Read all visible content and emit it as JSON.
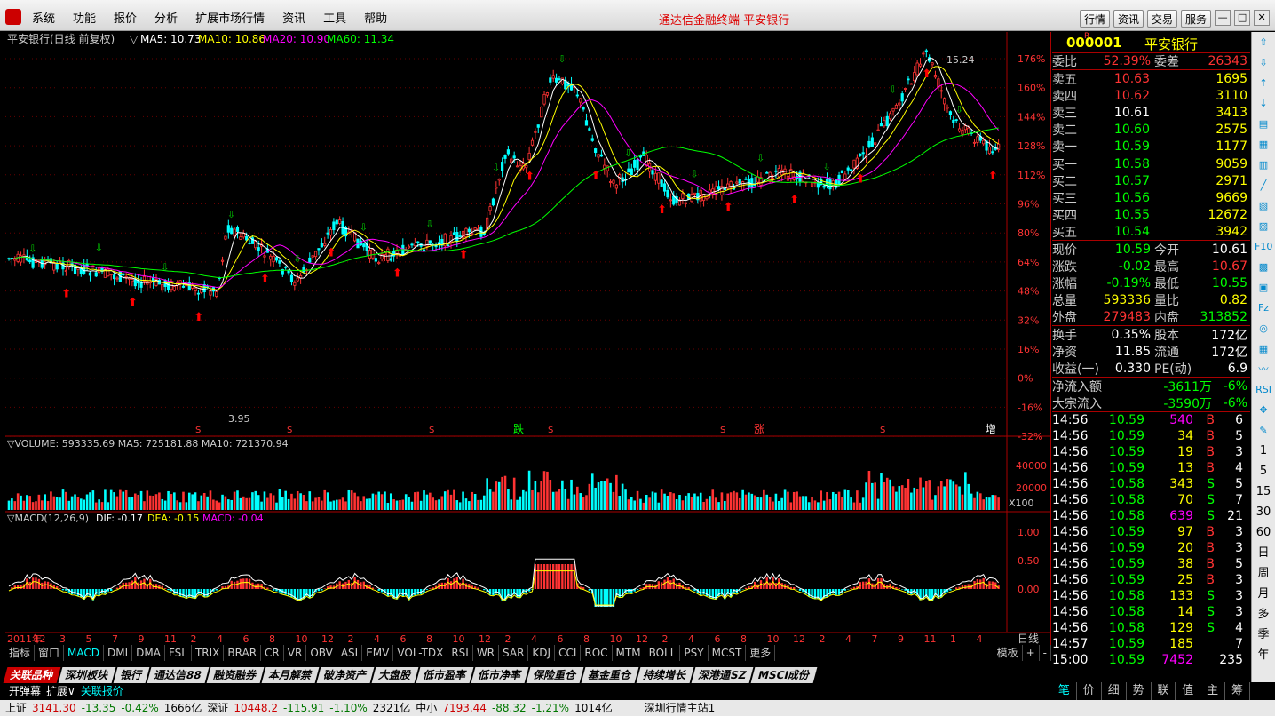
{
  "menubar": {
    "items": [
      "系统",
      "功能",
      "报价",
      "分析",
      "扩展市场行情",
      "资讯",
      "工具",
      "帮助"
    ],
    "title": "通达信金融终端  平安银行",
    "buttons": [
      "行情",
      "资讯",
      "交易",
      "服务"
    ]
  },
  "chart": {
    "main_header": {
      "name": "平安银行(日线 前复权)",
      "ma5": "MA5: 10.73",
      "ma10": "MA10: 10.86",
      "ma20": "MA20: 10.90",
      "ma60": "MA60: 11.34"
    },
    "pct_axis": [
      "176%",
      "160%",
      "144%",
      "128%",
      "112%",
      "96%",
      "80%",
      "64%",
      "48%",
      "32%",
      "16%",
      "0%",
      "-16%",
      "-32%"
    ],
    "high_label": "15.24",
    "low_label": "3.95",
    "markers": [
      "跌",
      "涨",
      "增"
    ],
    "vol_header": "▽VOLUME: 593335.69  MA5: 725181.88  MA10: 721370.94",
    "vol_axis": [
      "40000",
      "20000"
    ],
    "vol_unit": "X100",
    "macd_header": {
      "name": "▽MACD(12,26,9)",
      "dif": "DIF: -0.17",
      "dea": "DEA: -0.15",
      "macd": "MACD: -0.04"
    },
    "macd_axis": [
      "1.00",
      "0.50",
      "0.00"
    ],
    "date_axis": [
      "2011年",
      "12",
      "3",
      "5",
      "7",
      "9",
      "11",
      "2",
      "4",
      "6",
      "8",
      "10",
      "12",
      "2",
      "4",
      "6",
      "8",
      "10",
      "12",
      "2",
      "4",
      "6",
      "8",
      "10",
      "12",
      "2",
      "4",
      "6",
      "8",
      "10",
      "12",
      "2",
      "4",
      "7",
      "9",
      "11",
      "1",
      "4"
    ],
    "period_label": "日线"
  },
  "indicator_tabs": [
    "指标",
    "窗口",
    "MACD",
    "DMI",
    "DMA",
    "FSL",
    "TRIX",
    "BRAR",
    "CR",
    "VR",
    "OBV",
    "ASI",
    "EMV",
    "VOL-TDX",
    "RSI",
    "WR",
    "SAR",
    "KDJ",
    "CCI",
    "ROC",
    "MTM",
    "BOLL",
    "PSY",
    "MCST",
    "更多"
  ],
  "template_label": "模板",
  "category_tabs": [
    "关联品种",
    "深圳板块",
    "银行",
    "通达信88",
    "融资融券",
    "本月解禁",
    "破净资产",
    "大盘股",
    "低市盈率",
    "低市净率",
    "保险重仓",
    "基金重仓",
    "持续增长",
    "深港通SZ",
    "MSCI成份"
  ],
  "bottom_bar": [
    "开弹幕",
    "扩展∨",
    "关联报价"
  ],
  "quote": {
    "code": "000001",
    "name": "平安银行",
    "rongzi": "R",
    "weibi": {
      "label": "委比",
      "value": "52.39%",
      "label2": "委差",
      "value2": "26343"
    },
    "asks": [
      {
        "label": "卖五",
        "price": "10.63",
        "vol": "1695"
      },
      {
        "label": "卖四",
        "price": "10.62",
        "vol": "3110"
      },
      {
        "label": "卖三",
        "price": "10.61",
        "vol": "3413"
      },
      {
        "label": "卖二",
        "price": "10.60",
        "vol": "2575"
      },
      {
        "label": "卖一",
        "price": "10.59",
        "vol": "1177"
      }
    ],
    "bids": [
      {
        "label": "买一",
        "price": "10.58",
        "vol": "9059"
      },
      {
        "label": "买二",
        "price": "10.57",
        "vol": "2971"
      },
      {
        "label": "买三",
        "price": "10.56",
        "vol": "9669"
      },
      {
        "label": "买四",
        "price": "10.55",
        "vol": "12672"
      },
      {
        "label": "买五",
        "price": "10.54",
        "vol": "3942"
      }
    ],
    "stats": [
      {
        "l1": "现价",
        "v1": "10.59",
        "l2": "今开",
        "v2": "10.61"
      },
      {
        "l1": "涨跌",
        "v1": "-0.02",
        "l2": "最高",
        "v2": "10.67"
      },
      {
        "l1": "涨幅",
        "v1": "-0.19%",
        "l2": "最低",
        "v2": "10.55"
      },
      {
        "l1": "总量",
        "v1": "593336",
        "l2": "量比",
        "v2": "0.82"
      },
      {
        "l1": "外盘",
        "v1": "279483",
        "l2": "内盘",
        "v2": "313852"
      }
    ],
    "stats2": [
      {
        "l1": "换手",
        "v1": "0.35%",
        "l2": "股本",
        "v2": "172亿"
      },
      {
        "l1": "净资",
        "v1": "11.85",
        "l2": "流通",
        "v2": "172亿"
      },
      {
        "l1": "收益(一)",
        "v1": "0.330",
        "l2": "PE(动)",
        "v2": "6.9"
      }
    ],
    "flows": [
      {
        "label": "净流入额",
        "value": "-3611万",
        "pct": "-6%"
      },
      {
        "label": "大宗流入",
        "value": "-3590万",
        "pct": "-6%"
      }
    ],
    "ticks": [
      {
        "t": "14:56",
        "p": "10.59",
        "v": "540",
        "bs": "B",
        "n": "6"
      },
      {
        "t": "14:56",
        "p": "10.59",
        "v": "34",
        "bs": "B",
        "n": "5"
      },
      {
        "t": "14:56",
        "p": "10.59",
        "v": "19",
        "bs": "B",
        "n": "3"
      },
      {
        "t": "14:56",
        "p": "10.59",
        "v": "13",
        "bs": "B",
        "n": "4"
      },
      {
        "t": "14:56",
        "p": "10.58",
        "v": "343",
        "bs": "S",
        "n": "5"
      },
      {
        "t": "14:56",
        "p": "10.58",
        "v": "70",
        "bs": "S",
        "n": "7"
      },
      {
        "t": "14:56",
        "p": "10.58",
        "v": "639",
        "bs": "S",
        "n": "21"
      },
      {
        "t": "14:56",
        "p": "10.59",
        "v": "97",
        "bs": "B",
        "n": "3"
      },
      {
        "t": "14:56",
        "p": "10.59",
        "v": "20",
        "bs": "B",
        "n": "3"
      },
      {
        "t": "14:56",
        "p": "10.59",
        "v": "38",
        "bs": "B",
        "n": "5"
      },
      {
        "t": "14:56",
        "p": "10.59",
        "v": "25",
        "bs": "B",
        "n": "3"
      },
      {
        "t": "14:56",
        "p": "10.58",
        "v": "133",
        "bs": "S",
        "n": "3"
      },
      {
        "t": "14:56",
        "p": "10.58",
        "v": "14",
        "bs": "S",
        "n": "3"
      },
      {
        "t": "14:56",
        "p": "10.58",
        "v": "129",
        "bs": "S",
        "n": "4"
      },
      {
        "t": "14:57",
        "p": "10.59",
        "v": "185",
        "bs": "",
        "n": "7"
      },
      {
        "t": "15:00",
        "p": "10.59",
        "v": "7452",
        "bs": "",
        "n": "235"
      }
    ]
  },
  "right_tabs": [
    "笔",
    "价",
    "细",
    "势",
    "联",
    "值",
    "主",
    "筹"
  ],
  "right_tools": [
    "⇧",
    "⇩",
    "↑",
    "↓",
    "▤",
    "▦",
    "▥",
    "╱",
    "▧",
    "▨",
    "F10",
    "▩",
    "▣",
    "Fz",
    "◎",
    "▦",
    "〰",
    "RSI",
    "✥",
    "✎"
  ],
  "right_tools2": [
    "1",
    "5",
    "15",
    "30",
    "60",
    "日",
    "周",
    "月",
    "多",
    "季",
    "年"
  ],
  "status": {
    "sh": {
      "label": "上证",
      "index": "3141.30",
      "chg": "-13.35",
      "pct": "-0.42%",
      "amt": "1666亿"
    },
    "sz": {
      "label": "深证",
      "index": "10448.2",
      "chg": "-115.91",
      "pct": "-1.10%",
      "amt": "2321亿"
    },
    "zx": {
      "label": "中小",
      "index": "7193.44",
      "chg": "-88.32",
      "pct": "-1.21%",
      "amt": "1014亿"
    },
    "news": "深圳行情主站1"
  }
}
